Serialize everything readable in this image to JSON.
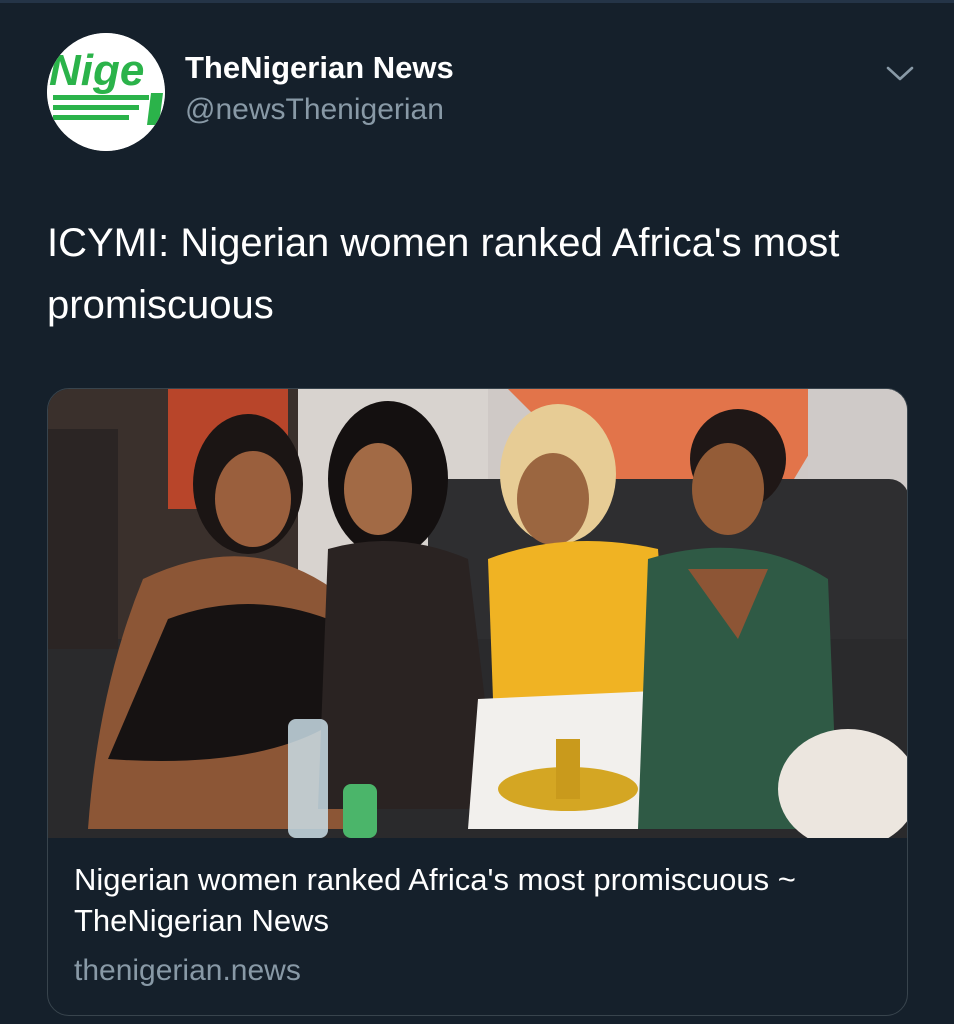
{
  "author": {
    "display_name": "TheNigerian News",
    "handle": "@newsThenigerian",
    "avatar_text": "Nige"
  },
  "tweet": {
    "text": "ICYMI: Nigerian women ranked Africa's most promiscuous"
  },
  "card": {
    "title": "Nigerian women ranked Africa's most promiscuous ~ TheNigerian News",
    "domain": "thenigerian.news"
  },
  "colors": {
    "background": "#15202b",
    "secondary_text": "#8899a6",
    "border": "#38444d",
    "brand_green": "#2bb34a"
  },
  "icons": {
    "more_menu": "chevron-down-icon"
  }
}
